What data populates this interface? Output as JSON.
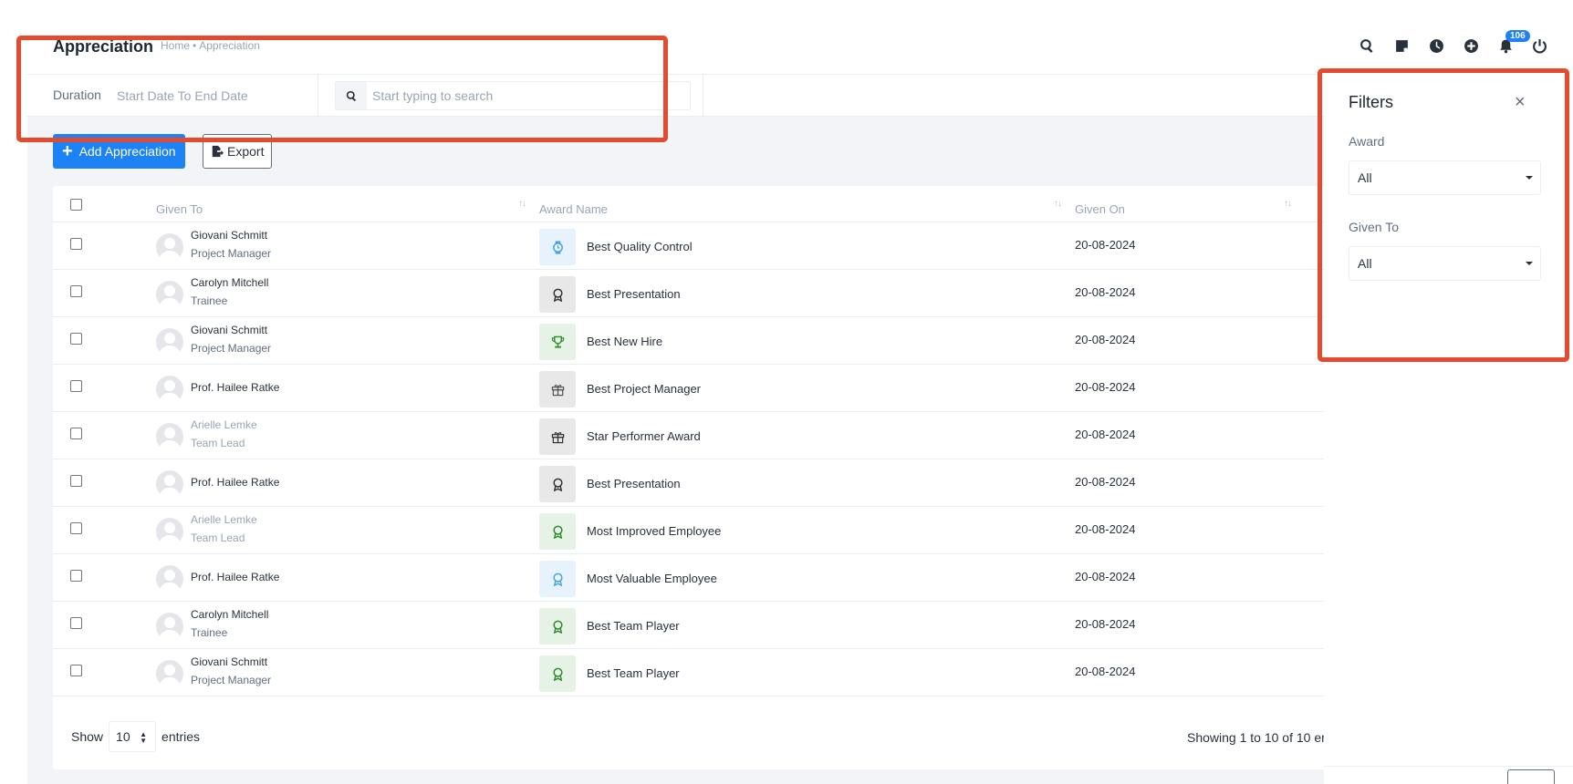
{
  "header": {
    "title": "Appreciation",
    "breadcrumb": {
      "home": "Home",
      "separator": "•",
      "current": "Appreciation"
    },
    "icons": [
      "search-icon",
      "sticky-note-icon",
      "clock-icon",
      "plus-circle-icon",
      "bell-icon",
      "power-icon"
    ],
    "notification_count": "106"
  },
  "filterbar": {
    "duration_label": "Duration",
    "duration_value": "Start Date To End Date",
    "search_placeholder": "Start typing to search"
  },
  "actions": {
    "add_label": "Add Appreciation",
    "export_label": "Export"
  },
  "table": {
    "columns": [
      "Given To",
      "Award Name",
      "Given On"
    ],
    "rows": [
      {
        "name": "Giovani Schmitt",
        "role": "Project Manager",
        "award": "Best Quality Control",
        "icon": "watch-icon",
        "icon_bg": "#e6f3fc",
        "icon_color": "#4aa3df",
        "date": "20-08-2024",
        "dim": false
      },
      {
        "name": "Carolyn Mitchell",
        "role": "Trainee",
        "award": "Best Presentation",
        "icon": "medal-icon",
        "icon_bg": "#e8e8e8",
        "icon_color": "#333333",
        "date": "20-08-2024",
        "dim": false
      },
      {
        "name": "Giovani Schmitt",
        "role": "Project Manager",
        "award": "Best New Hire",
        "icon": "trophy-icon",
        "icon_bg": "#e5f2e5",
        "icon_color": "#2e8b2e",
        "date": "20-08-2024",
        "dim": false
      },
      {
        "name": "Prof. Hailee Ratke",
        "role": "",
        "award": "Best Project Manager",
        "icon": "gift-icon",
        "icon_bg": "#e8e8e8",
        "icon_color": "#555555",
        "date": "20-08-2024",
        "dim": false
      },
      {
        "name": "Arielle Lemke",
        "role": "Team Lead",
        "award": "Star Performer Award",
        "icon": "gift-icon",
        "icon_bg": "#e8e8e8",
        "icon_color": "#333333",
        "date": "20-08-2024",
        "dim": true
      },
      {
        "name": "Prof. Hailee Ratke",
        "role": "",
        "award": "Best Presentation",
        "icon": "medal-icon",
        "icon_bg": "#e8e8e8",
        "icon_color": "#333333",
        "date": "20-08-2024",
        "dim": false
      },
      {
        "name": "Arielle Lemke",
        "role": "Team Lead",
        "award": "Most Improved Employee",
        "icon": "medal-icon",
        "icon_bg": "#e5f2e5",
        "icon_color": "#2e8b2e",
        "date": "20-08-2024",
        "dim": true
      },
      {
        "name": "Prof. Hailee Ratke",
        "role": "",
        "award": "Most Valuable Employee",
        "icon": "medal-icon",
        "icon_bg": "#e6f3fc",
        "icon_color": "#4aa3df",
        "date": "20-08-2024",
        "dim": false
      },
      {
        "name": "Carolyn Mitchell",
        "role": "Trainee",
        "award": "Best Team Player",
        "icon": "medal-icon",
        "icon_bg": "#e5f2e5",
        "icon_color": "#2e8b2e",
        "date": "20-08-2024",
        "dim": false
      },
      {
        "name": "Giovani Schmitt",
        "role": "Project Manager",
        "award": "Best Team Player",
        "icon": "medal-icon",
        "icon_bg": "#e5f2e5",
        "icon_color": "#2e8b2e",
        "date": "20-08-2024",
        "dim": false
      }
    ],
    "footer": {
      "show_label": "Show",
      "page_size": "10",
      "entries_label": "entries",
      "showing_text": "Showing 1 to 10 of 10 er"
    }
  },
  "filters_panel": {
    "title": "Filters",
    "close_glyph": "×",
    "award_label": "Award",
    "award_value": "All",
    "given_to_label": "Given To",
    "given_to_value": "All"
  },
  "colors": {
    "primary": "#1d82f5",
    "annotation": "#e64a2e",
    "background": "#f2f4f7"
  }
}
